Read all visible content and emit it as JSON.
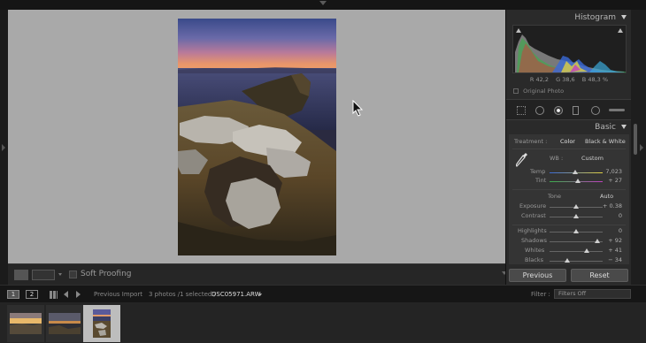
{
  "right_panel": {
    "histogram_title": "Histogram",
    "hist_r_label": "R",
    "hist_r_value": "42,2",
    "hist_g_label": "G",
    "hist_g_value": "38,6",
    "hist_b_label": "B",
    "hist_b_value": "48,3",
    "hist_unit": "%",
    "original_photo_label": "Original Photo",
    "basic_title": "Basic",
    "treatment_label": "Treatment :",
    "treatment_color": "Color",
    "treatment_bw": "Black & White",
    "wb_label": "WB :",
    "wb_value": "Custom",
    "temp_label": "Temp",
    "temp_value": "7,023",
    "tint_label": "Tint",
    "tint_value": "+ 27",
    "tone_label": "Tone",
    "tone_auto": "Auto",
    "exposure_label": "Exposure",
    "exposure_value": "+ 0.38",
    "contrast_label": "Contrast",
    "contrast_value": "0",
    "highlights_label": "Highlights",
    "highlights_value": "0",
    "shadows_label": "Shadows",
    "shadows_value": "+ 92",
    "whites_label": "Whites",
    "whites_value": "+ 41",
    "blacks_label": "Blacks",
    "blacks_value": "− 34",
    "previous_label": "Previous",
    "reset_label": "Reset"
  },
  "toolbar": {
    "soft_proofing_label": "Soft Proofing"
  },
  "filmstrip_bar": {
    "view1": "1",
    "view2": "2",
    "source": "Previous Import",
    "count_text": "3 photos /1 selected /",
    "filename": "DSC05971.ARW",
    "filter_label": "Filter :",
    "filter_value": "Filters Off"
  },
  "colors": {
    "canvas_bg": "#a9a9a9",
    "panel_bg": "#2a2a2a",
    "histogram_red": "#d23a3a",
    "histogram_green": "#3ab04a",
    "histogram_blue": "#3a6ad8"
  }
}
